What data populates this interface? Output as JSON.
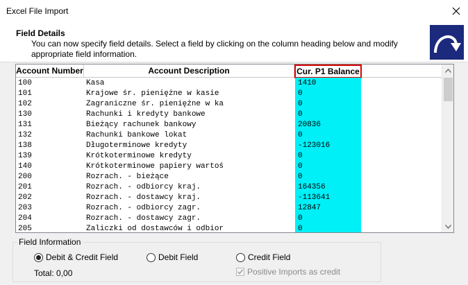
{
  "window": {
    "title": "Excel File Import"
  },
  "header": {
    "title": "Field Details",
    "description": "You can now specify field details. Select a field by clicking on the column heading below and modify appropriate field information."
  },
  "grid": {
    "columns": [
      "Account Number",
      "Account Description",
      "Cur. P1 Balance"
    ],
    "selected_column": "Cur. P1 Balance",
    "highlight_color": "#00f0f8",
    "rows": [
      [
        "100",
        "Kasa",
        "1410"
      ],
      [
        "101",
        "Krajowe śr. pieniężne w kasie",
        "0"
      ],
      [
        "102",
        "Zagraniczne śr. pieniężne w ka",
        "0"
      ],
      [
        "130",
        "Rachunki i kredyty bankowe",
        "0"
      ],
      [
        "131",
        "Bieżący rachunek bankowy",
        "20836"
      ],
      [
        "132",
        "Rachunki bankowe lokat",
        "0"
      ],
      [
        "138",
        "Długoterminowe kredyty",
        "-123016"
      ],
      [
        "139",
        "Krótkoterminowe kredyty",
        "0"
      ],
      [
        "140",
        "Krótkoterminowe papiery wartoś",
        "0"
      ],
      [
        "200",
        "Rozrach. - bieżące",
        "0"
      ],
      [
        "201",
        "Rozrach. - odbiorcy kraj.",
        "164356"
      ],
      [
        "202",
        "Rozrach. - dostawcy kraj.",
        "-113641"
      ],
      [
        "203",
        "Rozrach. - odbiorcy zagr.",
        "12847"
      ],
      [
        "204",
        "Rozrach. - dostawcy zagr.",
        "0"
      ],
      [
        "205",
        "Zaliczki od dostawców i odbior",
        "0"
      ]
    ]
  },
  "field_info": {
    "legend": "Field Information",
    "options": [
      "Debit & Credit Field",
      "Debit Field",
      "Credit Field"
    ],
    "selected": "Debit & Credit Field",
    "positive_credit_label": "Positive Imports as credit",
    "positive_credit_checked": true,
    "positive_credit_enabled": false,
    "total": "Total: 0,00"
  }
}
